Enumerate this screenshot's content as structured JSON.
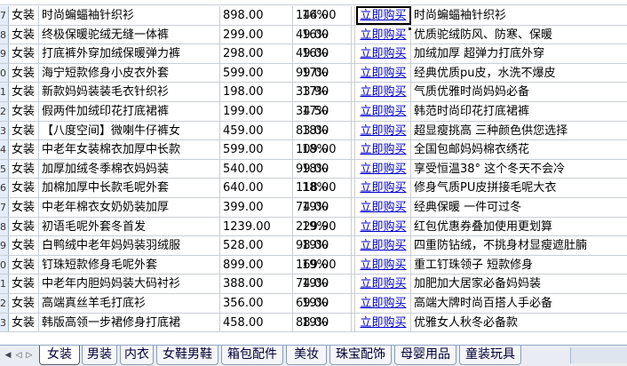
{
  "rows": [
    {
      "rownum": "7",
      "type": "女装",
      "name": "时尚蝙蝠袖针织衫",
      "price": "898.00",
      "commission": "144.00",
      "rate": "16%",
      "buy": "立即购买",
      "desc": "时尚蝙蝠袖针织衫"
    },
    {
      "rownum": "8",
      "type": "女装",
      "name": "终极保暖驼绒无缝一体裤",
      "price": "299.00",
      "commission": "49.00",
      "rate": "16%",
      "buy": "立即购买",
      "desc": "优质驼绒防风、防寒、保暖"
    },
    {
      "rownum": "9",
      "type": "女装",
      "name": "打底裤外穿加绒保暖弹力裤",
      "price": "298.00",
      "commission": "49.00",
      "rate": "16%",
      "buy": "立即购买",
      "desc": "加绒加厚 超弹力打底外穿"
    },
    {
      "rownum": "0",
      "type": "女装",
      "name": "海宁短款修身小皮衣外套",
      "price": "599.00",
      "commission": "99.00",
      "rate": "17%",
      "buy": "立即购买",
      "desc": "经典优质pu皮，水洗不爆皮"
    },
    {
      "rownum": "1",
      "type": "女装",
      "name": "新款妈妈装装毛衣针织衫",
      "price": "198.00",
      "commission": "33.90",
      "rate": "17%",
      "buy": "立即购买",
      "desc": "气质优雅时尚妈妈必备"
    },
    {
      "rownum": "2",
      "type": "女装",
      "name": "假两件加绒印花打底裙裤",
      "price": "199.00",
      "commission": "34.50",
      "rate": "17%",
      "buy": "立即购买",
      "desc": "韩范时尚印花打底裙裤"
    },
    {
      "rownum": "3",
      "type": "女装",
      "name": "【八度空间】微喇牛仔裤女",
      "price": "459.00",
      "commission": "83.00",
      "rate": "18%",
      "buy": "立即购买",
      "desc": "超显瘦挑高 三种颜色供您选择"
    },
    {
      "rownum": "4",
      "type": "女装",
      "name": "中老年女装棉衣加厚中长款",
      "price": "599.00",
      "commission": "109.00",
      "rate": "18%",
      "buy": "立即购买",
      "desc": "全国包邮妈妈棉衣绣花"
    },
    {
      "rownum": "5",
      "type": "女装",
      "name": "加厚加绒冬季棉衣妈妈装",
      "price": "540.00",
      "commission": "99.00",
      "rate": "18%",
      "buy": "立即购买",
      "desc": "享受恒温38° 这个冬天不会冷"
    },
    {
      "rownum": "6",
      "type": "女装",
      "name": "加棉加厚中长款毛呢外套",
      "price": "640.00",
      "commission": "118.00",
      "rate": "18%",
      "buy": "立即购买",
      "desc": "修身气质PU皮拼接毛呢大衣"
    },
    {
      "rownum": "7",
      "type": "女装",
      "name": "中老年棉衣女奶奶装加厚",
      "price": "399.00",
      "commission": "74.00",
      "rate": "19%",
      "buy": "立即购买",
      "desc": "经典保暖 一件可过冬"
    },
    {
      "rownum": "8",
      "type": "女装",
      "name": "初语毛呢外套冬首发",
      "price": "1239.00",
      "commission": "229.90",
      "rate": "19%",
      "buy": "立即购买",
      "desc": "红包优惠券叠加使用更划算"
    },
    {
      "rownum": "9",
      "type": "女装",
      "name": "白鸭绒中老年妈妈装羽绒服",
      "price": "528.00",
      "commission": "98.00",
      "rate": "19%",
      "buy": "立即购买",
      "desc": "四重防钻绒，不挑身材显瘦遮肚腩"
    },
    {
      "rownum": "0",
      "type": "女装",
      "name": "钉珠短款修身毛呢外套",
      "price": "899.00",
      "commission": "169.00",
      "rate": "19%",
      "buy": "立即购买",
      "desc": "重工钉珠领子 短款修身"
    },
    {
      "rownum": "1",
      "type": "女装",
      "name": "中老年内胆妈妈装大码衬衫",
      "price": "388.00",
      "commission": "74.00",
      "rate": "19%",
      "buy": "立即购买",
      "desc": "加肥加大居家必备妈妈装"
    },
    {
      "rownum": "2",
      "type": "女装",
      "name": "高端真丝羊毛打底衫",
      "price": "356.00",
      "commission": "69.00",
      "rate": "19%",
      "buy": "立即购买",
      "desc": "高端大牌时尚百搭人手必备"
    },
    {
      "rownum": "3",
      "type": "女装",
      "name": "韩版高领一步裙修身打底裙",
      "price": "458.00",
      "commission": "88.00",
      "rate": "19%",
      "buy": "立即购买",
      "desc": "优雅女人秋冬必备款"
    }
  ],
  "tabs": [
    "女装",
    "男装",
    "内衣",
    "女鞋男鞋",
    "箱包配件",
    "美妆",
    "珠宝配饰",
    "母婴用品",
    "童装玩具"
  ],
  "colors": {
    "grid": "#c9cfd6",
    "link": "#0000cc",
    "tabbar": "#e9edf3"
  }
}
